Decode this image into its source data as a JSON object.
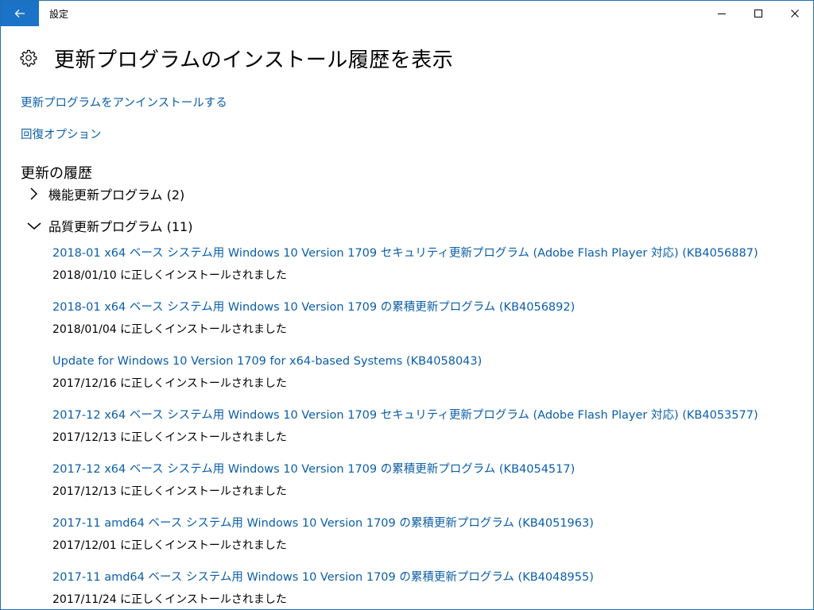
{
  "window": {
    "title": "設定"
  },
  "header": {
    "title": "更新プログラムのインストール履歴を表示",
    "icon": "gear-icon"
  },
  "links": {
    "uninstall": "更新プログラムをアンインストールする",
    "recovery": "回復オプション"
  },
  "history": {
    "title": "更新の履歴",
    "groups": [
      {
        "label": "機能更新プログラム (2)",
        "expanded": false
      },
      {
        "label": "品質更新プログラム (11)",
        "expanded": true
      }
    ],
    "updates": [
      {
        "title": "2018-01 x64 ベース システム用 Windows 10 Version 1709 セキュリティ更新プログラム (Adobe Flash Player 対応) (KB4056887)",
        "status": "2018/01/10 に正しくインストールされました"
      },
      {
        "title": "2018-01 x64 ベース システム用 Windows 10 Version 1709 の累積更新プログラム (KB4056892)",
        "status": "2018/01/04 に正しくインストールされました"
      },
      {
        "title": "Update for Windows 10 Version 1709 for x64-based Systems (KB4058043)",
        "status": "2017/12/16 に正しくインストールされました"
      },
      {
        "title": "2017-12 x64 ベース システム用 Windows 10 Version 1709 セキュリティ更新プログラム (Adobe Flash Player 対応) (KB4053577)",
        "status": "2017/12/13 に正しくインストールされました"
      },
      {
        "title": "2017-12 x64 ベース システム用 Windows 10 Version 1709 の累積更新プログラム (KB4054517)",
        "status": "2017/12/13 に正しくインストールされました"
      },
      {
        "title": "2017-11 amd64 ベース システム用 Windows 10 Version 1709 の累積更新プログラム (KB4051963)",
        "status": "2017/12/01 に正しくインストールされました"
      },
      {
        "title": "2017-11 amd64 ベース システム用 Windows 10 Version 1709 の累積更新プログラム (KB4048955)",
        "status": "2017/11/24 に正しくインストールされました"
      }
    ]
  },
  "colors": {
    "accent": "#1a73c7",
    "link": "#0b5ea8",
    "border": "#1f6fb5"
  }
}
